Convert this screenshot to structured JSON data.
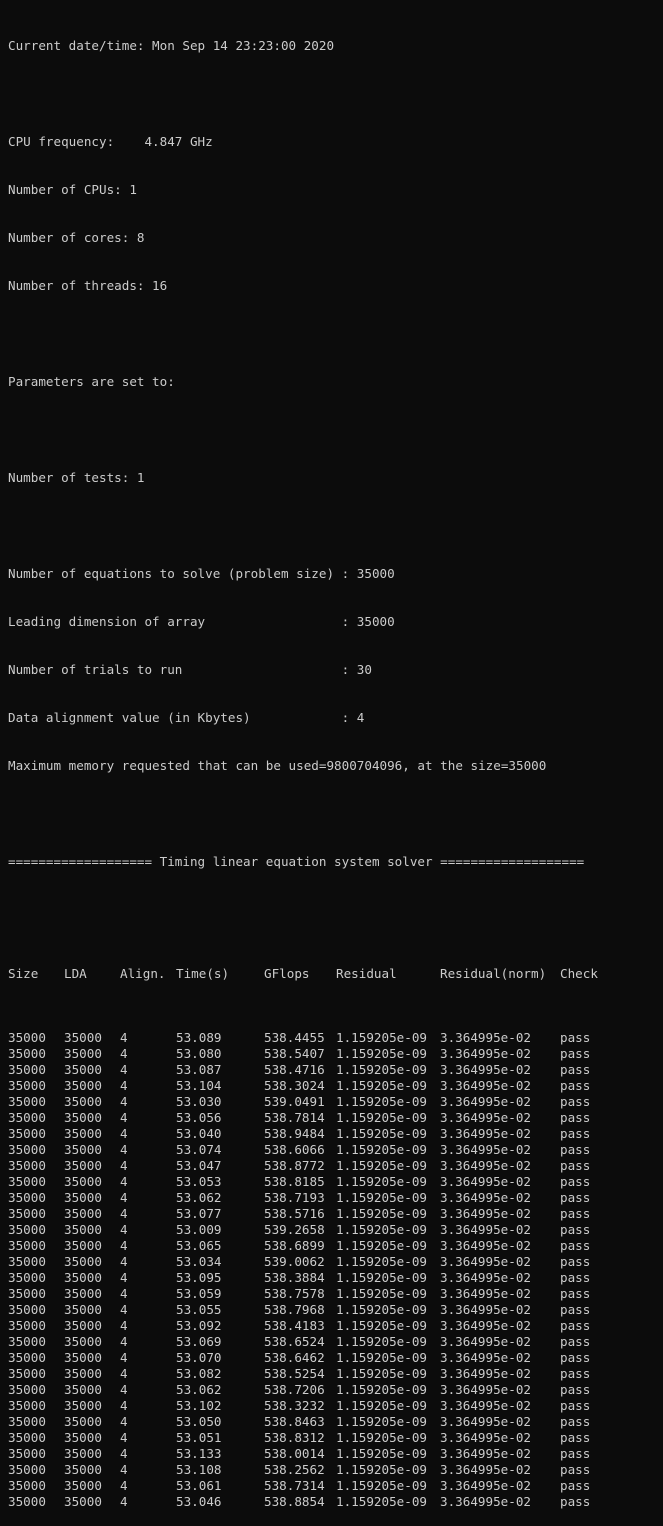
{
  "console": {
    "date_line": "Current date/time: Mon Sep 14 23:23:00 2020",
    "cpu_frequency": "CPU frequency:    4.847 GHz",
    "num_cpus": "Number of CPUs: 1",
    "num_cores": "Number of cores: 8",
    "num_threads": "Number of threads: 16",
    "params_header": "Parameters are set to:",
    "num_tests": "Number of tests: 1",
    "problem_size": "Number of equations to solve (problem size) : 35000",
    "leading_dim": "Leading dimension of array                  : 35000",
    "num_trials": "Number of trials to run                     : 30",
    "alignment": "Data alignment value (in Kbytes)            : 4",
    "max_memory": "Maximum memory requested that can be used=9800704096, at the size=35000",
    "timing_banner": "=================== Timing linear equation system solver ==================="
  },
  "table": {
    "headers": {
      "size": "Size",
      "lda": "LDA",
      "align": "Align.",
      "time": "Time(s)",
      "gflops": "GFlops",
      "residual": "Residual",
      "residual_norm": "Residual(norm)",
      "check": "Check"
    },
    "rows": [
      {
        "size": "35000",
        "lda": "35000",
        "align": "4",
        "time": "53.089",
        "gflops": "538.4455",
        "residual": "1.159205e-09",
        "residual_norm": "3.364995e-02",
        "check": "pass"
      },
      {
        "size": "35000",
        "lda": "35000",
        "align": "4",
        "time": "53.080",
        "gflops": "538.5407",
        "residual": "1.159205e-09",
        "residual_norm": "3.364995e-02",
        "check": "pass"
      },
      {
        "size": "35000",
        "lda": "35000",
        "align": "4",
        "time": "53.087",
        "gflops": "538.4716",
        "residual": "1.159205e-09",
        "residual_norm": "3.364995e-02",
        "check": "pass"
      },
      {
        "size": "35000",
        "lda": "35000",
        "align": "4",
        "time": "53.104",
        "gflops": "538.3024",
        "residual": "1.159205e-09",
        "residual_norm": "3.364995e-02",
        "check": "pass"
      },
      {
        "size": "35000",
        "lda": "35000",
        "align": "4",
        "time": "53.030",
        "gflops": "539.0491",
        "residual": "1.159205e-09",
        "residual_norm": "3.364995e-02",
        "check": "pass"
      },
      {
        "size": "35000",
        "lda": "35000",
        "align": "4",
        "time": "53.056",
        "gflops": "538.7814",
        "residual": "1.159205e-09",
        "residual_norm": "3.364995e-02",
        "check": "pass"
      },
      {
        "size": "35000",
        "lda": "35000",
        "align": "4",
        "time": "53.040",
        "gflops": "538.9484",
        "residual": "1.159205e-09",
        "residual_norm": "3.364995e-02",
        "check": "pass"
      },
      {
        "size": "35000",
        "lda": "35000",
        "align": "4",
        "time": "53.074",
        "gflops": "538.6066",
        "residual": "1.159205e-09",
        "residual_norm": "3.364995e-02",
        "check": "pass"
      },
      {
        "size": "35000",
        "lda": "35000",
        "align": "4",
        "time": "53.047",
        "gflops": "538.8772",
        "residual": "1.159205e-09",
        "residual_norm": "3.364995e-02",
        "check": "pass"
      },
      {
        "size": "35000",
        "lda": "35000",
        "align": "4",
        "time": "53.053",
        "gflops": "538.8185",
        "residual": "1.159205e-09",
        "residual_norm": "3.364995e-02",
        "check": "pass"
      },
      {
        "size": "35000",
        "lda": "35000",
        "align": "4",
        "time": "53.062",
        "gflops": "538.7193",
        "residual": "1.159205e-09",
        "residual_norm": "3.364995e-02",
        "check": "pass"
      },
      {
        "size": "35000",
        "lda": "35000",
        "align": "4",
        "time": "53.077",
        "gflops": "538.5716",
        "residual": "1.159205e-09",
        "residual_norm": "3.364995e-02",
        "check": "pass"
      },
      {
        "size": "35000",
        "lda": "35000",
        "align": "4",
        "time": "53.009",
        "gflops": "539.2658",
        "residual": "1.159205e-09",
        "residual_norm": "3.364995e-02",
        "check": "pass"
      },
      {
        "size": "35000",
        "lda": "35000",
        "align": "4",
        "time": "53.065",
        "gflops": "538.6899",
        "residual": "1.159205e-09",
        "residual_norm": "3.364995e-02",
        "check": "pass"
      },
      {
        "size": "35000",
        "lda": "35000",
        "align": "4",
        "time": "53.034",
        "gflops": "539.0062",
        "residual": "1.159205e-09",
        "residual_norm": "3.364995e-02",
        "check": "pass"
      },
      {
        "size": "35000",
        "lda": "35000",
        "align": "4",
        "time": "53.095",
        "gflops": "538.3884",
        "residual": "1.159205e-09",
        "residual_norm": "3.364995e-02",
        "check": "pass"
      },
      {
        "size": "35000",
        "lda": "35000",
        "align": "4",
        "time": "53.059",
        "gflops": "538.7578",
        "residual": "1.159205e-09",
        "residual_norm": "3.364995e-02",
        "check": "pass"
      },
      {
        "size": "35000",
        "lda": "35000",
        "align": "4",
        "time": "53.055",
        "gflops": "538.7968",
        "residual": "1.159205e-09",
        "residual_norm": "3.364995e-02",
        "check": "pass"
      },
      {
        "size": "35000",
        "lda": "35000",
        "align": "4",
        "time": "53.092",
        "gflops": "538.4183",
        "residual": "1.159205e-09",
        "residual_norm": "3.364995e-02",
        "check": "pass"
      },
      {
        "size": "35000",
        "lda": "35000",
        "align": "4",
        "time": "53.069",
        "gflops": "538.6524",
        "residual": "1.159205e-09",
        "residual_norm": "3.364995e-02",
        "check": "pass"
      },
      {
        "size": "35000",
        "lda": "35000",
        "align": "4",
        "time": "53.070",
        "gflops": "538.6462",
        "residual": "1.159205e-09",
        "residual_norm": "3.364995e-02",
        "check": "pass"
      },
      {
        "size": "35000",
        "lda": "35000",
        "align": "4",
        "time": "53.082",
        "gflops": "538.5254",
        "residual": "1.159205e-09",
        "residual_norm": "3.364995e-02",
        "check": "pass"
      },
      {
        "size": "35000",
        "lda": "35000",
        "align": "4",
        "time": "53.062",
        "gflops": "538.7206",
        "residual": "1.159205e-09",
        "residual_norm": "3.364995e-02",
        "check": "pass"
      },
      {
        "size": "35000",
        "lda": "35000",
        "align": "4",
        "time": "53.102",
        "gflops": "538.3232",
        "residual": "1.159205e-09",
        "residual_norm": "3.364995e-02",
        "check": "pass"
      },
      {
        "size": "35000",
        "lda": "35000",
        "align": "4",
        "time": "53.050",
        "gflops": "538.8463",
        "residual": "1.159205e-09",
        "residual_norm": "3.364995e-02",
        "check": "pass"
      },
      {
        "size": "35000",
        "lda": "35000",
        "align": "4",
        "time": "53.051",
        "gflops": "538.8312",
        "residual": "1.159205e-09",
        "residual_norm": "3.364995e-02",
        "check": "pass"
      },
      {
        "size": "35000",
        "lda": "35000",
        "align": "4",
        "time": "53.133",
        "gflops": "538.0014",
        "residual": "1.159205e-09",
        "residual_norm": "3.364995e-02",
        "check": "pass"
      },
      {
        "size": "35000",
        "lda": "35000",
        "align": "4",
        "time": "53.108",
        "gflops": "538.2562",
        "residual": "1.159205e-09",
        "residual_norm": "3.364995e-02",
        "check": "pass"
      },
      {
        "size": "35000",
        "lda": "35000",
        "align": "4",
        "time": "53.061",
        "gflops": "538.7314",
        "residual": "1.159205e-09",
        "residual_norm": "3.364995e-02",
        "check": "pass"
      },
      {
        "size": "35000",
        "lda": "35000",
        "align": "4",
        "time": "53.046",
        "gflops": "538.8854",
        "residual": "1.159205e-09",
        "residual_norm": "3.364995e-02",
        "check": "pass"
      }
    ]
  },
  "colors": {
    "background": "#0c0c0c",
    "text": "#cccccc"
  }
}
